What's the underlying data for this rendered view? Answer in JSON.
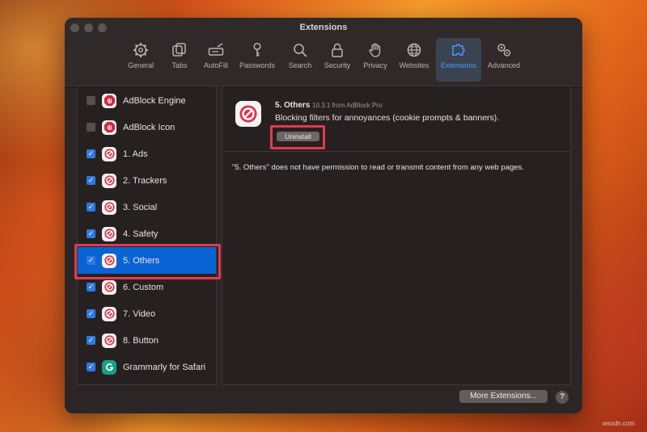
{
  "window": {
    "title": "Extensions"
  },
  "toolbar": [
    {
      "label": "General",
      "icon": "gear-icon"
    },
    {
      "label": "Tabs",
      "icon": "tabs-icon"
    },
    {
      "label": "AutoFill",
      "icon": "autofill-icon"
    },
    {
      "label": "Passwords",
      "icon": "key-icon"
    },
    {
      "label": "Search",
      "icon": "search-icon"
    },
    {
      "label": "Security",
      "icon": "lock-icon"
    },
    {
      "label": "Privacy",
      "icon": "hand-icon"
    },
    {
      "label": "Websites",
      "icon": "globe-icon"
    },
    {
      "label": "Extensions",
      "icon": "puzzle-icon",
      "active": true
    },
    {
      "label": "Advanced",
      "icon": "gears-icon"
    }
  ],
  "extensions": [
    {
      "label": "AdBlock Engine",
      "checked": false,
      "icon": "adblock-hand-icon"
    },
    {
      "label": "AdBlock Icon",
      "checked": false,
      "icon": "adblock-hand-icon"
    },
    {
      "label": "1. Ads",
      "checked": true,
      "icon": "block-icon"
    },
    {
      "label": "2. Trackers",
      "checked": true,
      "icon": "block-icon"
    },
    {
      "label": "3. Social",
      "checked": true,
      "icon": "block-icon"
    },
    {
      "label": "4. Safety",
      "checked": true,
      "icon": "block-icon"
    },
    {
      "label": "5. Others",
      "checked": true,
      "icon": "block-icon",
      "selected": true
    },
    {
      "label": "6. Custom",
      "checked": true,
      "icon": "block-icon"
    },
    {
      "label": "7. Video",
      "checked": true,
      "icon": "block-icon"
    },
    {
      "label": "8. Button",
      "checked": true,
      "icon": "block-icon"
    },
    {
      "label": "Grammarly for Safari",
      "checked": true,
      "icon": "grammarly-icon"
    }
  ],
  "detail": {
    "name": "5. Others",
    "version": "10.3.1 from AdBlock Pro",
    "description": "Blocking filters for annoyances (cookie prompts & banners).",
    "uninstall_label": "Uninstall",
    "permission_text": "\"5. Others\" does not have permission to read or transmit content from any web pages."
  },
  "footer": {
    "more_label": "More Extensions...",
    "help_label": "?"
  },
  "watermark": "wsxdn.com",
  "colors": {
    "accent": "#0a63d4",
    "highlight": "#e23a4e",
    "block_red": "#e0334a"
  }
}
